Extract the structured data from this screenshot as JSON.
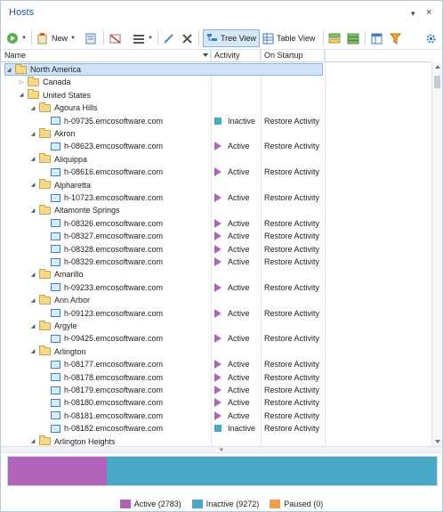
{
  "panel": {
    "title": "Hosts",
    "pin_glyph": "▾",
    "close_glyph": "×"
  },
  "toolbar": {
    "new_label": "New",
    "tree_view_label": "Tree View",
    "table_view_label": "Table View"
  },
  "columns": {
    "name": "Name",
    "activity": "Activity",
    "on_startup": "On Startup"
  },
  "colors": {
    "active": "#b064b9",
    "inactive": "#4aa8c7",
    "paused": "#f49c4a",
    "accent": "#1e5a96",
    "selection": "#cfe3f6"
  },
  "rows": [
    {
      "type": "folder",
      "level": 0,
      "expanded": true,
      "label": "North America",
      "selected": true,
      "activity": "",
      "on_startup": ""
    },
    {
      "type": "folder",
      "level": 1,
      "expanded": false,
      "label": "Canada",
      "activity": "",
      "on_startup": ""
    },
    {
      "type": "folder",
      "level": 1,
      "expanded": true,
      "label": "United States",
      "activity": "",
      "on_startup": ""
    },
    {
      "type": "folder",
      "level": 2,
      "expanded": true,
      "label": "Agoura Hills",
      "activity": "",
      "on_startup": ""
    },
    {
      "type": "host",
      "level": 3,
      "label": "h-09735.emcosoftware.com",
      "activity": "Inactive",
      "state": "inactive",
      "on_startup": "Restore Activity"
    },
    {
      "type": "folder",
      "level": 2,
      "expanded": true,
      "label": "Akron",
      "activity": "",
      "on_startup": ""
    },
    {
      "type": "host",
      "level": 3,
      "label": "h-08623.emcosoftware.com",
      "activity": "Active",
      "state": "active",
      "on_startup": "Restore Activity"
    },
    {
      "type": "folder",
      "level": 2,
      "expanded": true,
      "label": "Aliquippa",
      "activity": "",
      "on_startup": ""
    },
    {
      "type": "host",
      "level": 3,
      "label": "h-08616.emcosoftware.com",
      "activity": "Active",
      "state": "active",
      "on_startup": "Restore Activity"
    },
    {
      "type": "folder",
      "level": 2,
      "expanded": true,
      "label": "Alpharetta",
      "activity": "",
      "on_startup": ""
    },
    {
      "type": "host",
      "level": 3,
      "label": "h-10723.emcosoftware.com",
      "activity": "Active",
      "state": "active",
      "on_startup": "Restore Activity"
    },
    {
      "type": "folder",
      "level": 2,
      "expanded": true,
      "label": "Altamonte Springs",
      "activity": "",
      "on_startup": ""
    },
    {
      "type": "host",
      "level": 3,
      "label": "h-08326.emcosoftware.com",
      "activity": "Active",
      "state": "active",
      "on_startup": "Restore Activity"
    },
    {
      "type": "host",
      "level": 3,
      "label": "h-08327.emcosoftware.com",
      "activity": "Active",
      "state": "active",
      "on_startup": "Restore Activity"
    },
    {
      "type": "host",
      "level": 3,
      "label": "h-08328.emcosoftware.com",
      "activity": "Active",
      "state": "active",
      "on_startup": "Restore Activity"
    },
    {
      "type": "host",
      "level": 3,
      "label": "h-08329.emcosoftware.com",
      "activity": "Active",
      "state": "active",
      "on_startup": "Restore Activity"
    },
    {
      "type": "folder",
      "level": 2,
      "expanded": true,
      "label": "Amarillo",
      "activity": "",
      "on_startup": ""
    },
    {
      "type": "host",
      "level": 3,
      "label": "h-09233.emcosoftware.com",
      "activity": "Active",
      "state": "active",
      "on_startup": "Restore Activity"
    },
    {
      "type": "folder",
      "level": 2,
      "expanded": true,
      "label": "Ann Arbor",
      "activity": "",
      "on_startup": ""
    },
    {
      "type": "host",
      "level": 3,
      "label": "h-09123.emcosoftware.com",
      "activity": "Active",
      "state": "active",
      "on_startup": "Restore Activity"
    },
    {
      "type": "folder",
      "level": 2,
      "expanded": true,
      "label": "Argyle",
      "activity": "",
      "on_startup": ""
    },
    {
      "type": "host",
      "level": 3,
      "label": "h-09425.emcosoftware.com",
      "activity": "Active",
      "state": "active",
      "on_startup": "Restore Activity"
    },
    {
      "type": "folder",
      "level": 2,
      "expanded": true,
      "label": "Arlington",
      "activity": "",
      "on_startup": ""
    },
    {
      "type": "host",
      "level": 3,
      "label": "h-08177.emcosoftware.com",
      "activity": "Active",
      "state": "active",
      "on_startup": "Restore Activity"
    },
    {
      "type": "host",
      "level": 3,
      "label": "h-08178.emcosoftware.com",
      "activity": "Active",
      "state": "active",
      "on_startup": "Restore Activity"
    },
    {
      "type": "host",
      "level": 3,
      "label": "h-08179.emcosoftware.com",
      "activity": "Active",
      "state": "active",
      "on_startup": "Restore Activity"
    },
    {
      "type": "host",
      "level": 3,
      "label": "h-08180.emcosoftware.com",
      "activity": "Active",
      "state": "active",
      "on_startup": "Restore Activity"
    },
    {
      "type": "host",
      "level": 3,
      "label": "h-08181.emcosoftware.com",
      "activity": "Active",
      "state": "active",
      "on_startup": "Restore Activity"
    },
    {
      "type": "host",
      "level": 3,
      "label": "h-08182.emcosoftware.com",
      "activity": "Inactive",
      "state": "inactive",
      "on_startup": "Restore Activity"
    },
    {
      "type": "folder",
      "level": 2,
      "expanded": true,
      "label": "Arlington Heights",
      "activity": "",
      "on_startup": ""
    }
  ],
  "status": {
    "counts": {
      "active": 2783,
      "inactive": 9272,
      "paused": 0
    },
    "legend": [
      {
        "key": "active",
        "label": "Active (2783)"
      },
      {
        "key": "inactive",
        "label": "Inactive (9272)"
      },
      {
        "key": "paused",
        "label": "Paused (0)"
      }
    ]
  }
}
